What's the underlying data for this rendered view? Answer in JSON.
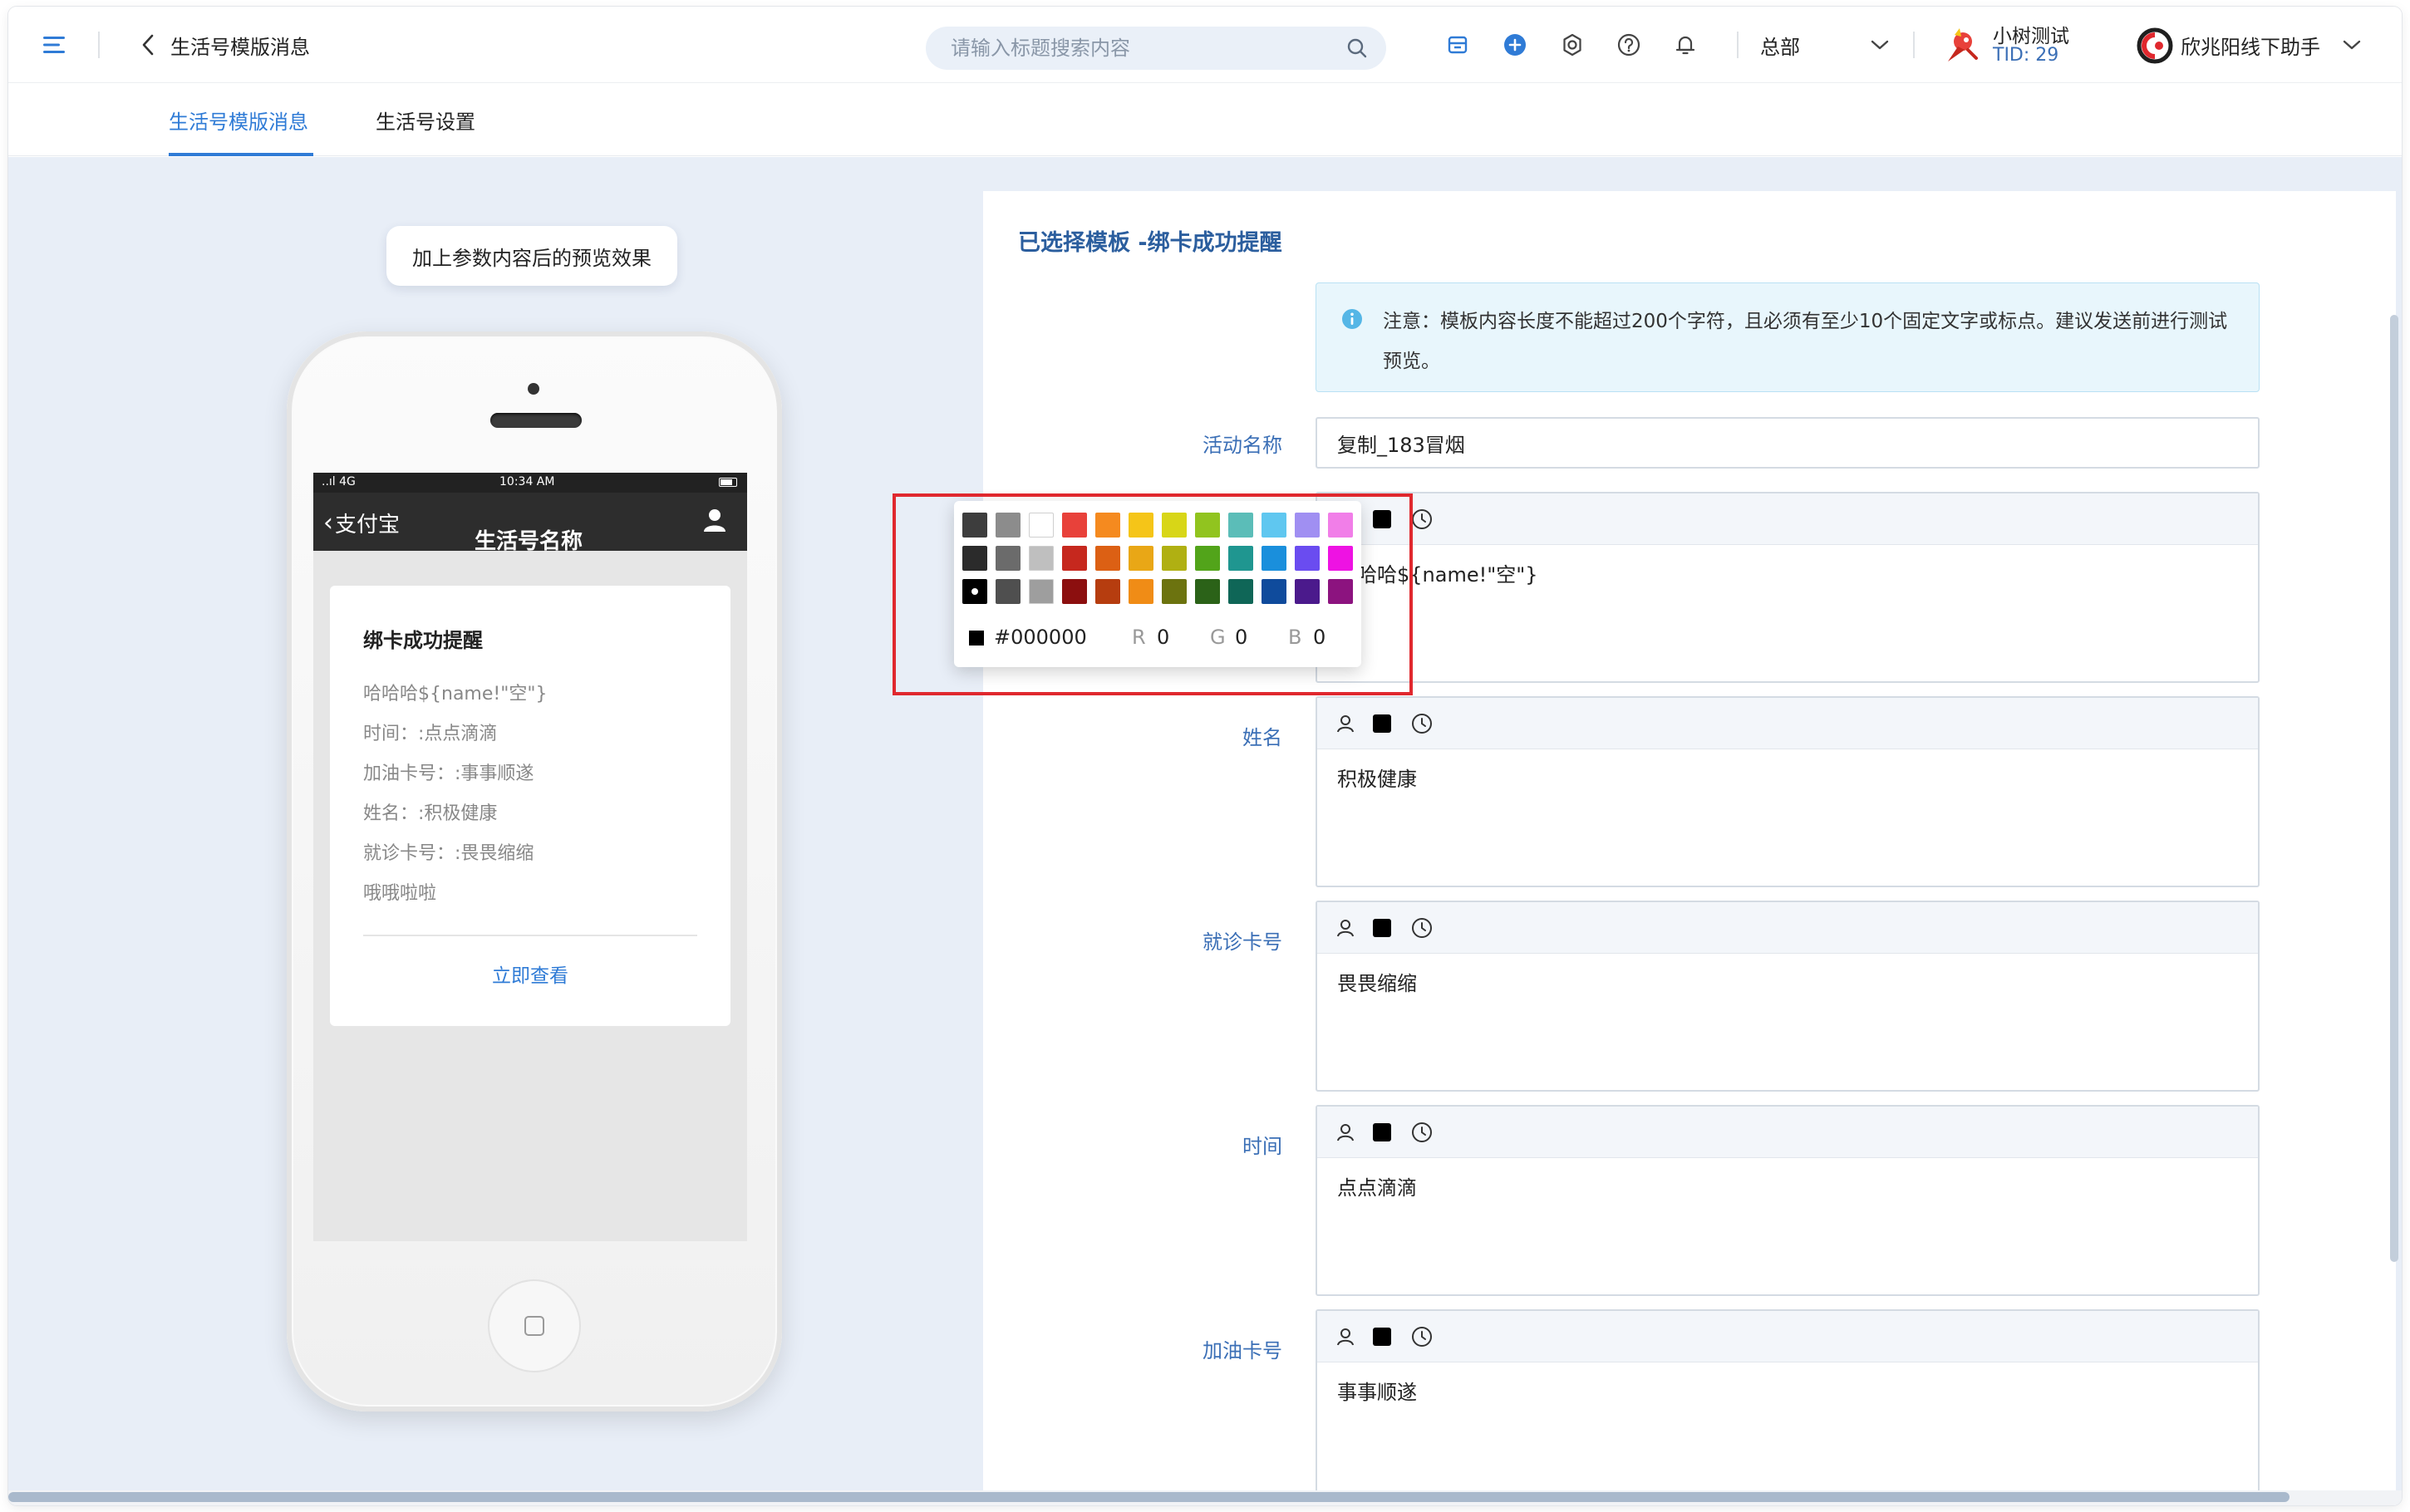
{
  "header": {
    "title": "生活号模版消息",
    "search_placeholder": "请输入标题搜索内容",
    "branch": "总部",
    "shop_name": "小树测试",
    "shop_tid": "TID: 29",
    "account_name": "欣兆阳线下助手"
  },
  "tabs": [
    {
      "label": "生活号模版消息",
      "active": true
    },
    {
      "label": "生活号设置",
      "active": false
    }
  ],
  "preview": {
    "badge": "加上参数内容后的预览效果",
    "status_signal": "..ıl 4G",
    "status_time": "10:34 AM",
    "nav_back": "支付宝",
    "nav_title": "生活号名称",
    "card": {
      "title": "绑卡成功提醒",
      "lines": [
        "哈哈哈${name!\"空\"}",
        "时间：:点点滴滴",
        "加油卡号：:事事顺遂",
        "姓名：:积极健康",
        "就诊卡号：:畏畏缩缩",
        "哦哦啦啦"
      ],
      "link": "立即查看"
    }
  },
  "form": {
    "heading": "已选择模板 -绑卡成功提醒",
    "notice": "注意：模板内容长度不能超过200个字符，且必须有至少10个固定文字或标点。建议发送前进行测试预览。",
    "activity_label": "活动名称",
    "activity_value": "复制_183冒烟",
    "fields": [
      {
        "label": "",
        "value": "哈哈哈${name!\"空\"}"
      },
      {
        "label": "姓名",
        "value": "积极健康"
      },
      {
        "label": "就诊卡号",
        "value": "畏畏缩缩"
      },
      {
        "label": "时间",
        "value": "点点滴滴"
      },
      {
        "label": "加油卡号",
        "value": "事事顺遂"
      }
    ]
  },
  "color_picker": {
    "hex": "#000000",
    "r_label": "R",
    "r": "0",
    "g_label": "G",
    "g": "0",
    "b_label": "B",
    "b": "0",
    "rows": [
      [
        "#3d3d3d",
        "#8c8c8c",
        "#ffffff",
        "#e8413a",
        "#f58a1f",
        "#f5c518",
        "#d8d617",
        "#91c41f",
        "#5bbdb8",
        "#5fc7f0",
        "#a08ff2",
        "#f17ee8"
      ],
      [
        "#2b2b2b",
        "#6b6b6b",
        "#bfbfbf",
        "#c6281e",
        "#dc6014",
        "#e9a716",
        "#b0b012",
        "#52a41a",
        "#1f9690",
        "#1a8fdc",
        "#6a4cf0",
        "#ee12e3"
      ],
      [
        "#000000",
        "#4f4f4f",
        "#9e9e9e",
        "#8c0f0f",
        "#b63d0f",
        "#f08c16",
        "#6c730f",
        "#2b6218",
        "#0f6657",
        "#0f4b9c",
        "#4b1a8c",
        "#8c137f"
      ]
    ],
    "selected": "#000000"
  },
  "colors": {
    "accent": "#2f7bd6",
    "label": "#3b6fb6",
    "content_bg": "#e8eef7",
    "highlight": "#e0282e"
  }
}
